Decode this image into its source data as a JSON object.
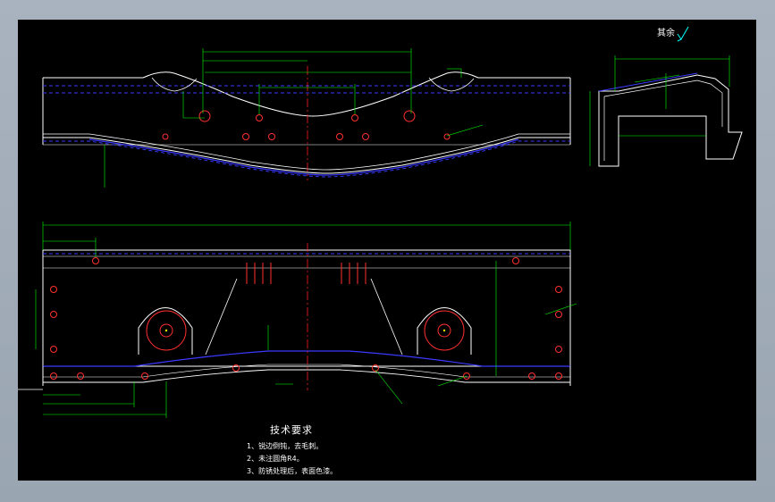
{
  "title_block": {
    "notes_title": "技术要求",
    "notes": [
      "1、锐边倒钝，去毛刺。",
      "2、未注圆角R4。",
      "3、防锈处理后，表面色漆。"
    ]
  },
  "roughness_mark": "其余",
  "colors": {
    "background": "#000000",
    "window_frame": "#a3adb9",
    "outline": "#ffffff",
    "dimension": "#00ff00",
    "hidden_line": "#3a3aff",
    "centerline": "#ff2020",
    "hole": "#ff3030",
    "hole_center": "#ffff00",
    "symbol": "#00ffff"
  },
  "icons": {
    "surface_finish": "roughness-check-icon"
  }
}
